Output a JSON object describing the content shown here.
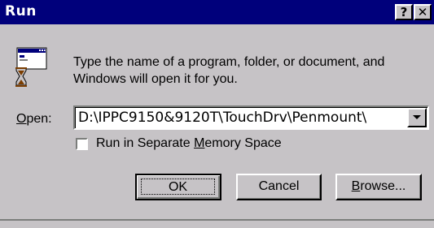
{
  "window": {
    "title": "Run",
    "help_glyph": "?",
    "close_glyph": "✕"
  },
  "icon": "run-program-icon",
  "description": "Type the name of a program, folder, or document, and Windows will open it for you.",
  "open": {
    "label_accel": "O",
    "label_rest": "pen:",
    "value": "D:\\IPPC9150&9120T\\TouchDrv\\Penmount\\"
  },
  "checkbox": {
    "label_pre": "Run in Separate ",
    "label_accel": "M",
    "label_post": "emory Space",
    "checked": false
  },
  "buttons": {
    "ok": "OK",
    "cancel": "Cancel",
    "browse_accel": "B",
    "browse_rest": "rowse..."
  },
  "colors": {
    "titlebar": "#00007b",
    "face": "#c6c3c6"
  }
}
